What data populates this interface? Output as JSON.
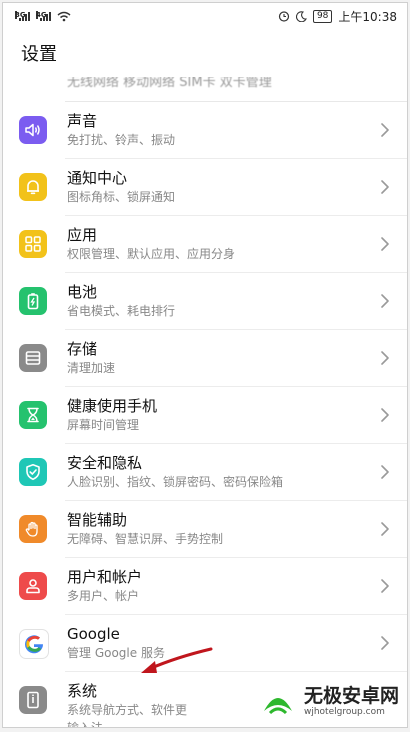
{
  "status_bar": {
    "sig1_label": "3G",
    "sig2_label": "4G",
    "battery": "98",
    "time": "上午10:38"
  },
  "header": {
    "title": "设置"
  },
  "partial_top_text": "无线网络 移动网络 SIM卡 双卡管理",
  "items": [
    {
      "title": "声音",
      "subtitle": "免打扰、铃声、振动",
      "icon": "sound-icon",
      "color": "#7b5cf0"
    },
    {
      "title": "通知中心",
      "subtitle": "图标角标、锁屏通知",
      "icon": "bell-icon",
      "color": "#f2c21a"
    },
    {
      "title": "应用",
      "subtitle": "权限管理、默认应用、应用分身",
      "icon": "apps-grid-icon",
      "color": "#f2c21a"
    },
    {
      "title": "电池",
      "subtitle": "省电模式、耗电排行",
      "icon": "battery-icon",
      "color": "#25c26e"
    },
    {
      "title": "存储",
      "subtitle": "清理加速",
      "icon": "storage-icon",
      "color": "#8a8a8a"
    },
    {
      "title": "健康使用手机",
      "subtitle": "屏幕时间管理",
      "icon": "hourglass-icon",
      "color": "#25c26e"
    },
    {
      "title": "安全和隐私",
      "subtitle": "人脸识别、指纹、锁屏密码、密码保险箱",
      "icon": "shield-icon",
      "color": "#1fc7b6"
    },
    {
      "title": "智能辅助",
      "subtitle": "无障碍、智慧识屏、手势控制",
      "icon": "hand-icon",
      "color": "#f08a2a"
    },
    {
      "title": "用户和帐户",
      "subtitle": "多用户、帐户",
      "icon": "user-icon",
      "color": "#ee4b4b"
    },
    {
      "title": "Google",
      "subtitle": "管理 Google 服务",
      "icon": "google-icon",
      "color": "#ffffff"
    }
  ],
  "last_item": {
    "title": "系统",
    "subtitle": "系统导航方式、软件更",
    "subtitle2": "输入法",
    "icon": "phone-info-icon",
    "color": "#8a8a8a"
  },
  "watermark": {
    "name": "无极安卓网",
    "url": "wjhotelgroup.com",
    "color": "#2eb82e"
  },
  "annotation_arrow_color": "#c0161d"
}
